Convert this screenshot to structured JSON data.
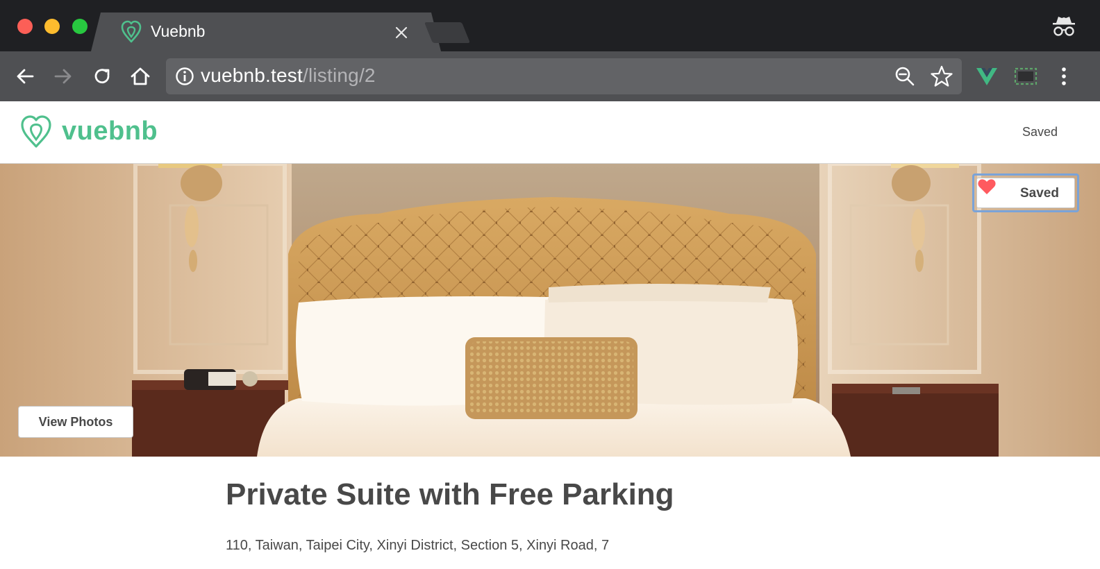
{
  "browser": {
    "tab_title": "Vuebnb",
    "url_host": "vuebnb.test",
    "url_path": "/listing/2",
    "icons": [
      "close-icon",
      "back-icon",
      "forward-icon",
      "reload-icon",
      "home-icon",
      "info-icon",
      "zoom-out-icon",
      "star-icon",
      "vue-devtools-icon",
      "cast-icon",
      "more-icon",
      "incognito-icon"
    ]
  },
  "header": {
    "logo_text": "vuebnb",
    "nav_saved": "Saved"
  },
  "hero": {
    "saved_button_label": "Saved",
    "view_photos_label": "View Photos"
  },
  "listing": {
    "title": "Private Suite with Free Parking",
    "address": "110, Taiwan, Taipei City, Xinyi District, Section 5, Xinyi Road, 7"
  },
  "colors": {
    "brand": "#4fc08d",
    "heart": "#ff5a5f",
    "text": "#484848",
    "chrome_dark": "#1f2023",
    "chrome_toolbar": "#4f5053"
  }
}
